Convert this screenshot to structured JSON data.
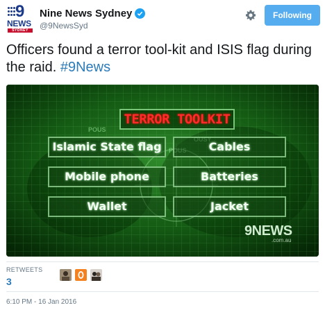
{
  "account": {
    "name": "Nine News Sydney",
    "handle": "@9NewsSyd",
    "avatar_text": {
      "nine": "9",
      "news": "NEWS",
      "city": "SYDNEY"
    }
  },
  "actions": {
    "settings_icon": "gear-icon",
    "follow_label": "Following"
  },
  "tweet": {
    "text": "Officers found a terror tool-kit and ISIS flag during the raid. ",
    "hashtag": "#9News"
  },
  "media": {
    "title": "TERROR TOOLKIT",
    "items": [
      "Islamic State flag",
      "Cables",
      "Mobile phone",
      "Batteries",
      "Wallet",
      "Jacket"
    ],
    "watermark": "9NEWS",
    "watermark_sub": ".com.au",
    "background_text": [
      "POUS",
      "POUS",
      "OUSY"
    ],
    "colors": {
      "screen": "#0f4a12",
      "title": "#ff2a2a"
    }
  },
  "stats": {
    "retweets_label": "RETWEETS",
    "retweets_count": "3"
  },
  "timestamp": "6:10 PM - 16 Jan 2016",
  "colors": {
    "follow_button": "#55acee",
    "hashtag": "#2b7bb9",
    "verified": "#1da1f2"
  }
}
